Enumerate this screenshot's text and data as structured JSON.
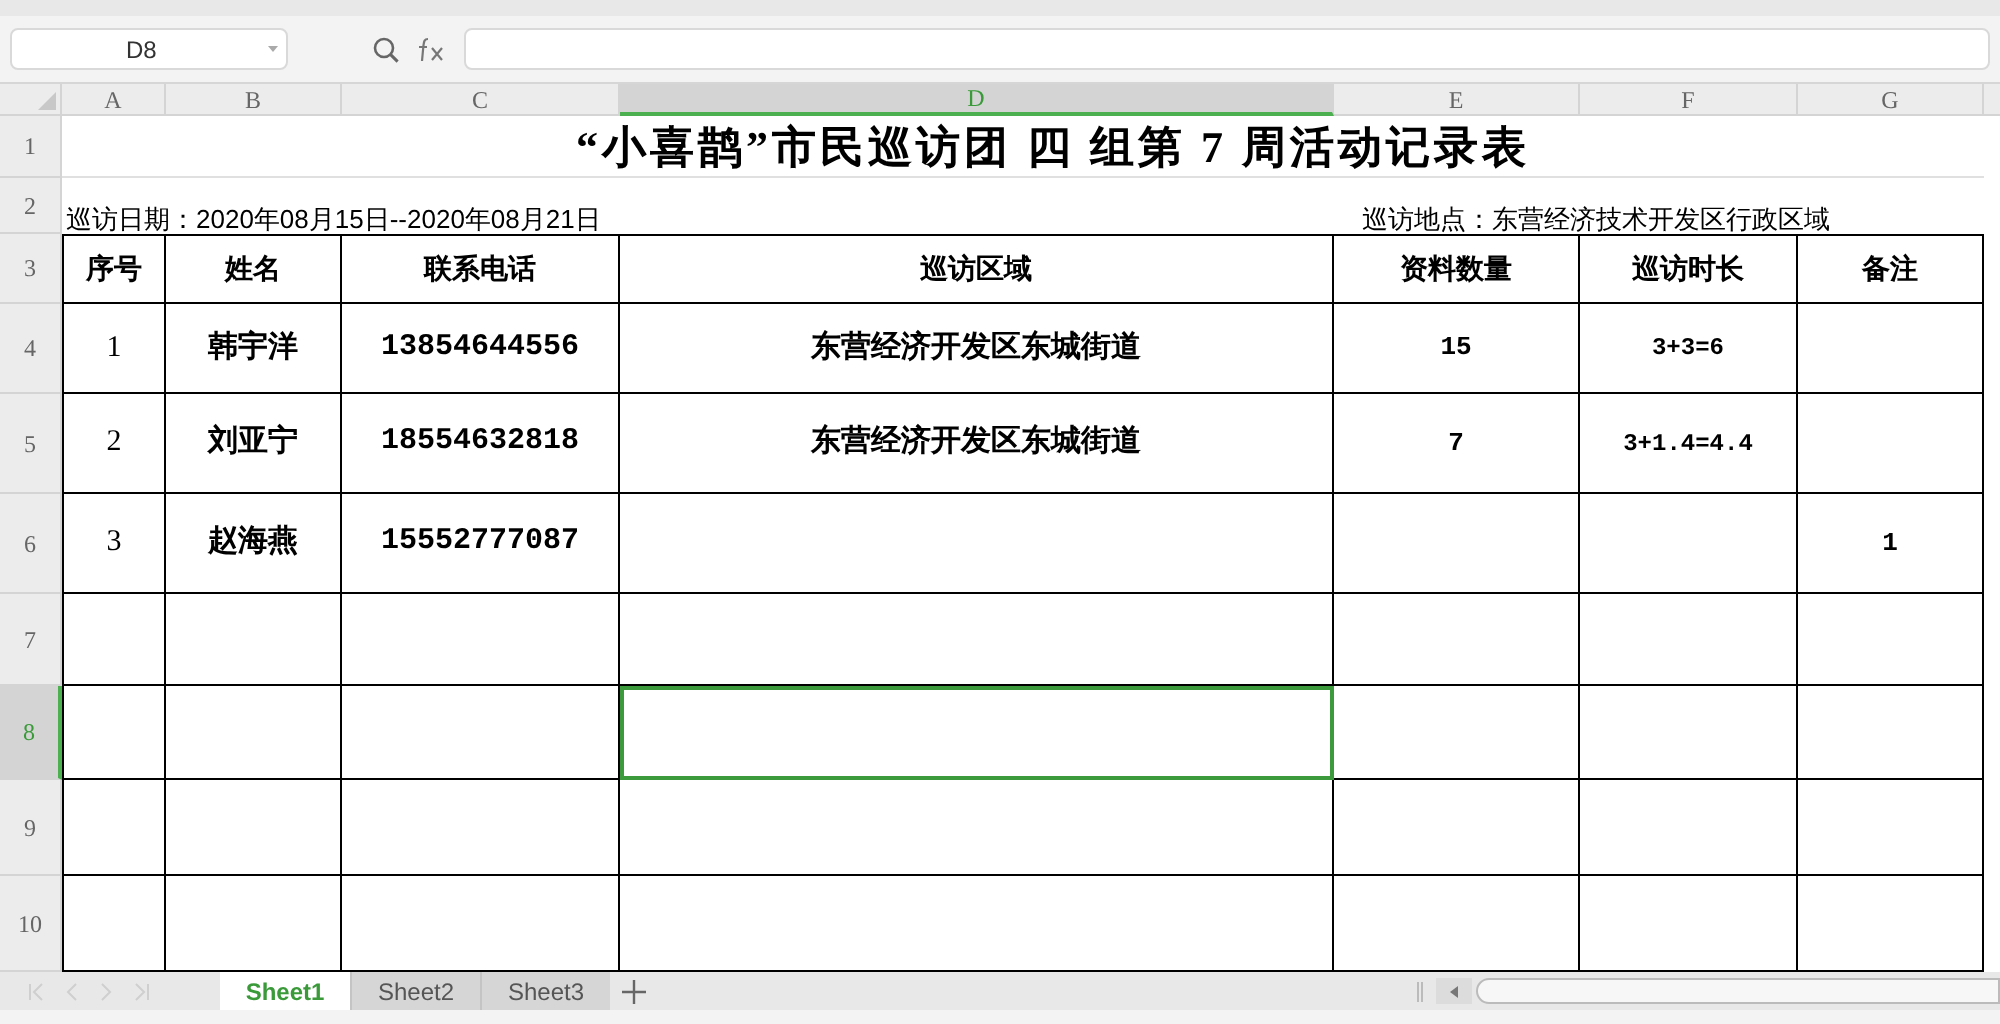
{
  "name_box": "D8",
  "columns": [
    {
      "label": "A",
      "selected": false
    },
    {
      "label": "B",
      "selected": false
    },
    {
      "label": "C",
      "selected": false
    },
    {
      "label": "D",
      "selected": true
    },
    {
      "label": "E",
      "selected": false
    },
    {
      "label": "F",
      "selected": false
    },
    {
      "label": "G",
      "selected": false
    }
  ],
  "rows": [
    {
      "label": "1",
      "selected": false
    },
    {
      "label": "2",
      "selected": false
    },
    {
      "label": "3",
      "selected": false
    },
    {
      "label": "4",
      "selected": false
    },
    {
      "label": "5",
      "selected": false
    },
    {
      "label": "6",
      "selected": false
    },
    {
      "label": "7",
      "selected": false
    },
    {
      "label": "8",
      "selected": true
    },
    {
      "label": "9",
      "selected": false
    },
    {
      "label": "10",
      "selected": false
    }
  ],
  "title": "“小喜鹊”市民巡访团 四 组第 7 周活动记录表",
  "date_text": "巡访日期：2020年08月15日--2020年08月21日",
  "location_text": "巡访地点：东营经济技术开发区行政区域",
  "table": {
    "headers": [
      "序号",
      "姓名",
      "联系电话",
      "巡访区域",
      "资料数量",
      "巡访时长",
      "备注"
    ],
    "rows": [
      [
        "1",
        "韩宇洋",
        "13854644556",
        "东营经济开发区东城街道",
        "15",
        "3+3=6",
        ""
      ],
      [
        "2",
        "刘亚宁",
        "18554632818",
        "东营经济开发区东城街道",
        "7",
        "3+1.4=4.4",
        ""
      ],
      [
        "3",
        "赵海燕",
        "15552777087",
        "",
        "",
        "",
        "1"
      ]
    ]
  },
  "sheets": [
    {
      "label": "Sheet1",
      "selected": true
    },
    {
      "label": "Sheet2",
      "selected": false
    },
    {
      "label": "Sheet3",
      "selected": false
    }
  ]
}
